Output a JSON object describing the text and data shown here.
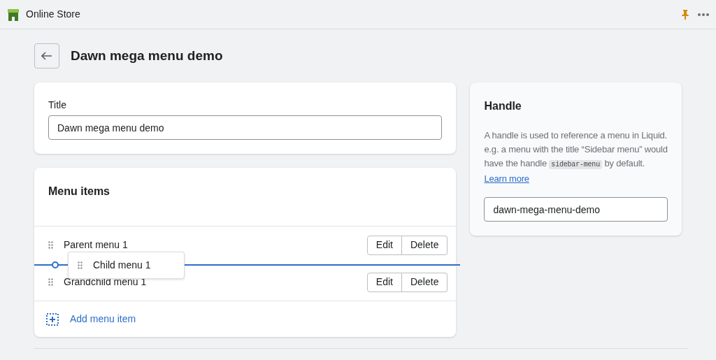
{
  "app_bar": {
    "title": "Online Store"
  },
  "page": {
    "title": "Dawn mega menu demo"
  },
  "title_card": {
    "label": "Title",
    "value": "Dawn mega menu demo"
  },
  "menu_items": {
    "heading": "Menu items",
    "items": [
      {
        "label": "Parent menu 1",
        "buttons": [
          "Edit",
          "Delete"
        ]
      },
      {
        "label": "Grandchild menu 1",
        "buttons": [
          "Edit",
          "Delete"
        ]
      }
    ],
    "dragging": {
      "label": "Child menu 1"
    },
    "add_link": "Add menu item"
  },
  "handle_card": {
    "heading": "Handle",
    "description_before": "A handle is used to reference a menu in Liquid. e.g. a menu with the title “Sidebar menu” would have the handle",
    "code": "sidebar-menu",
    "description_after": "by default.",
    "link": "Learn more",
    "value": "dawn-mega-menu-demo"
  }
}
